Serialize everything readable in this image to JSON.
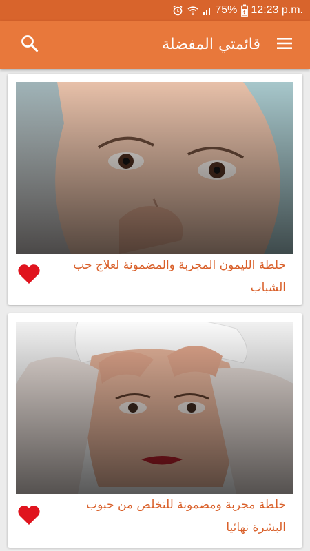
{
  "status_bar": {
    "battery_percent": "75%",
    "time": "12:23 p.m.",
    "icons": [
      "alarm-icon",
      "wifi-icon",
      "signal-icon",
      "battery-icon"
    ]
  },
  "app_bar": {
    "title": "قائمتي المفضلة",
    "menu_icon": "menu-icon",
    "search_icon": "search-icon"
  },
  "favorites": [
    {
      "title": "خلطة الليمون المجربة والمضمونة لعلاج حب الشباب",
      "favorite_icon": "heart-icon",
      "is_favorite": true
    },
    {
      "title": "خلطة مجربة ومضمونة للتخلص من حبوب البشرة نهائيا",
      "favorite_icon": "heart-icon",
      "is_favorite": true
    }
  ],
  "colors": {
    "status_bar": "#d8642c",
    "app_bar": "#e8783b",
    "title_text": "#d9602a",
    "heart": "#e0141e",
    "background": "#ececec"
  }
}
